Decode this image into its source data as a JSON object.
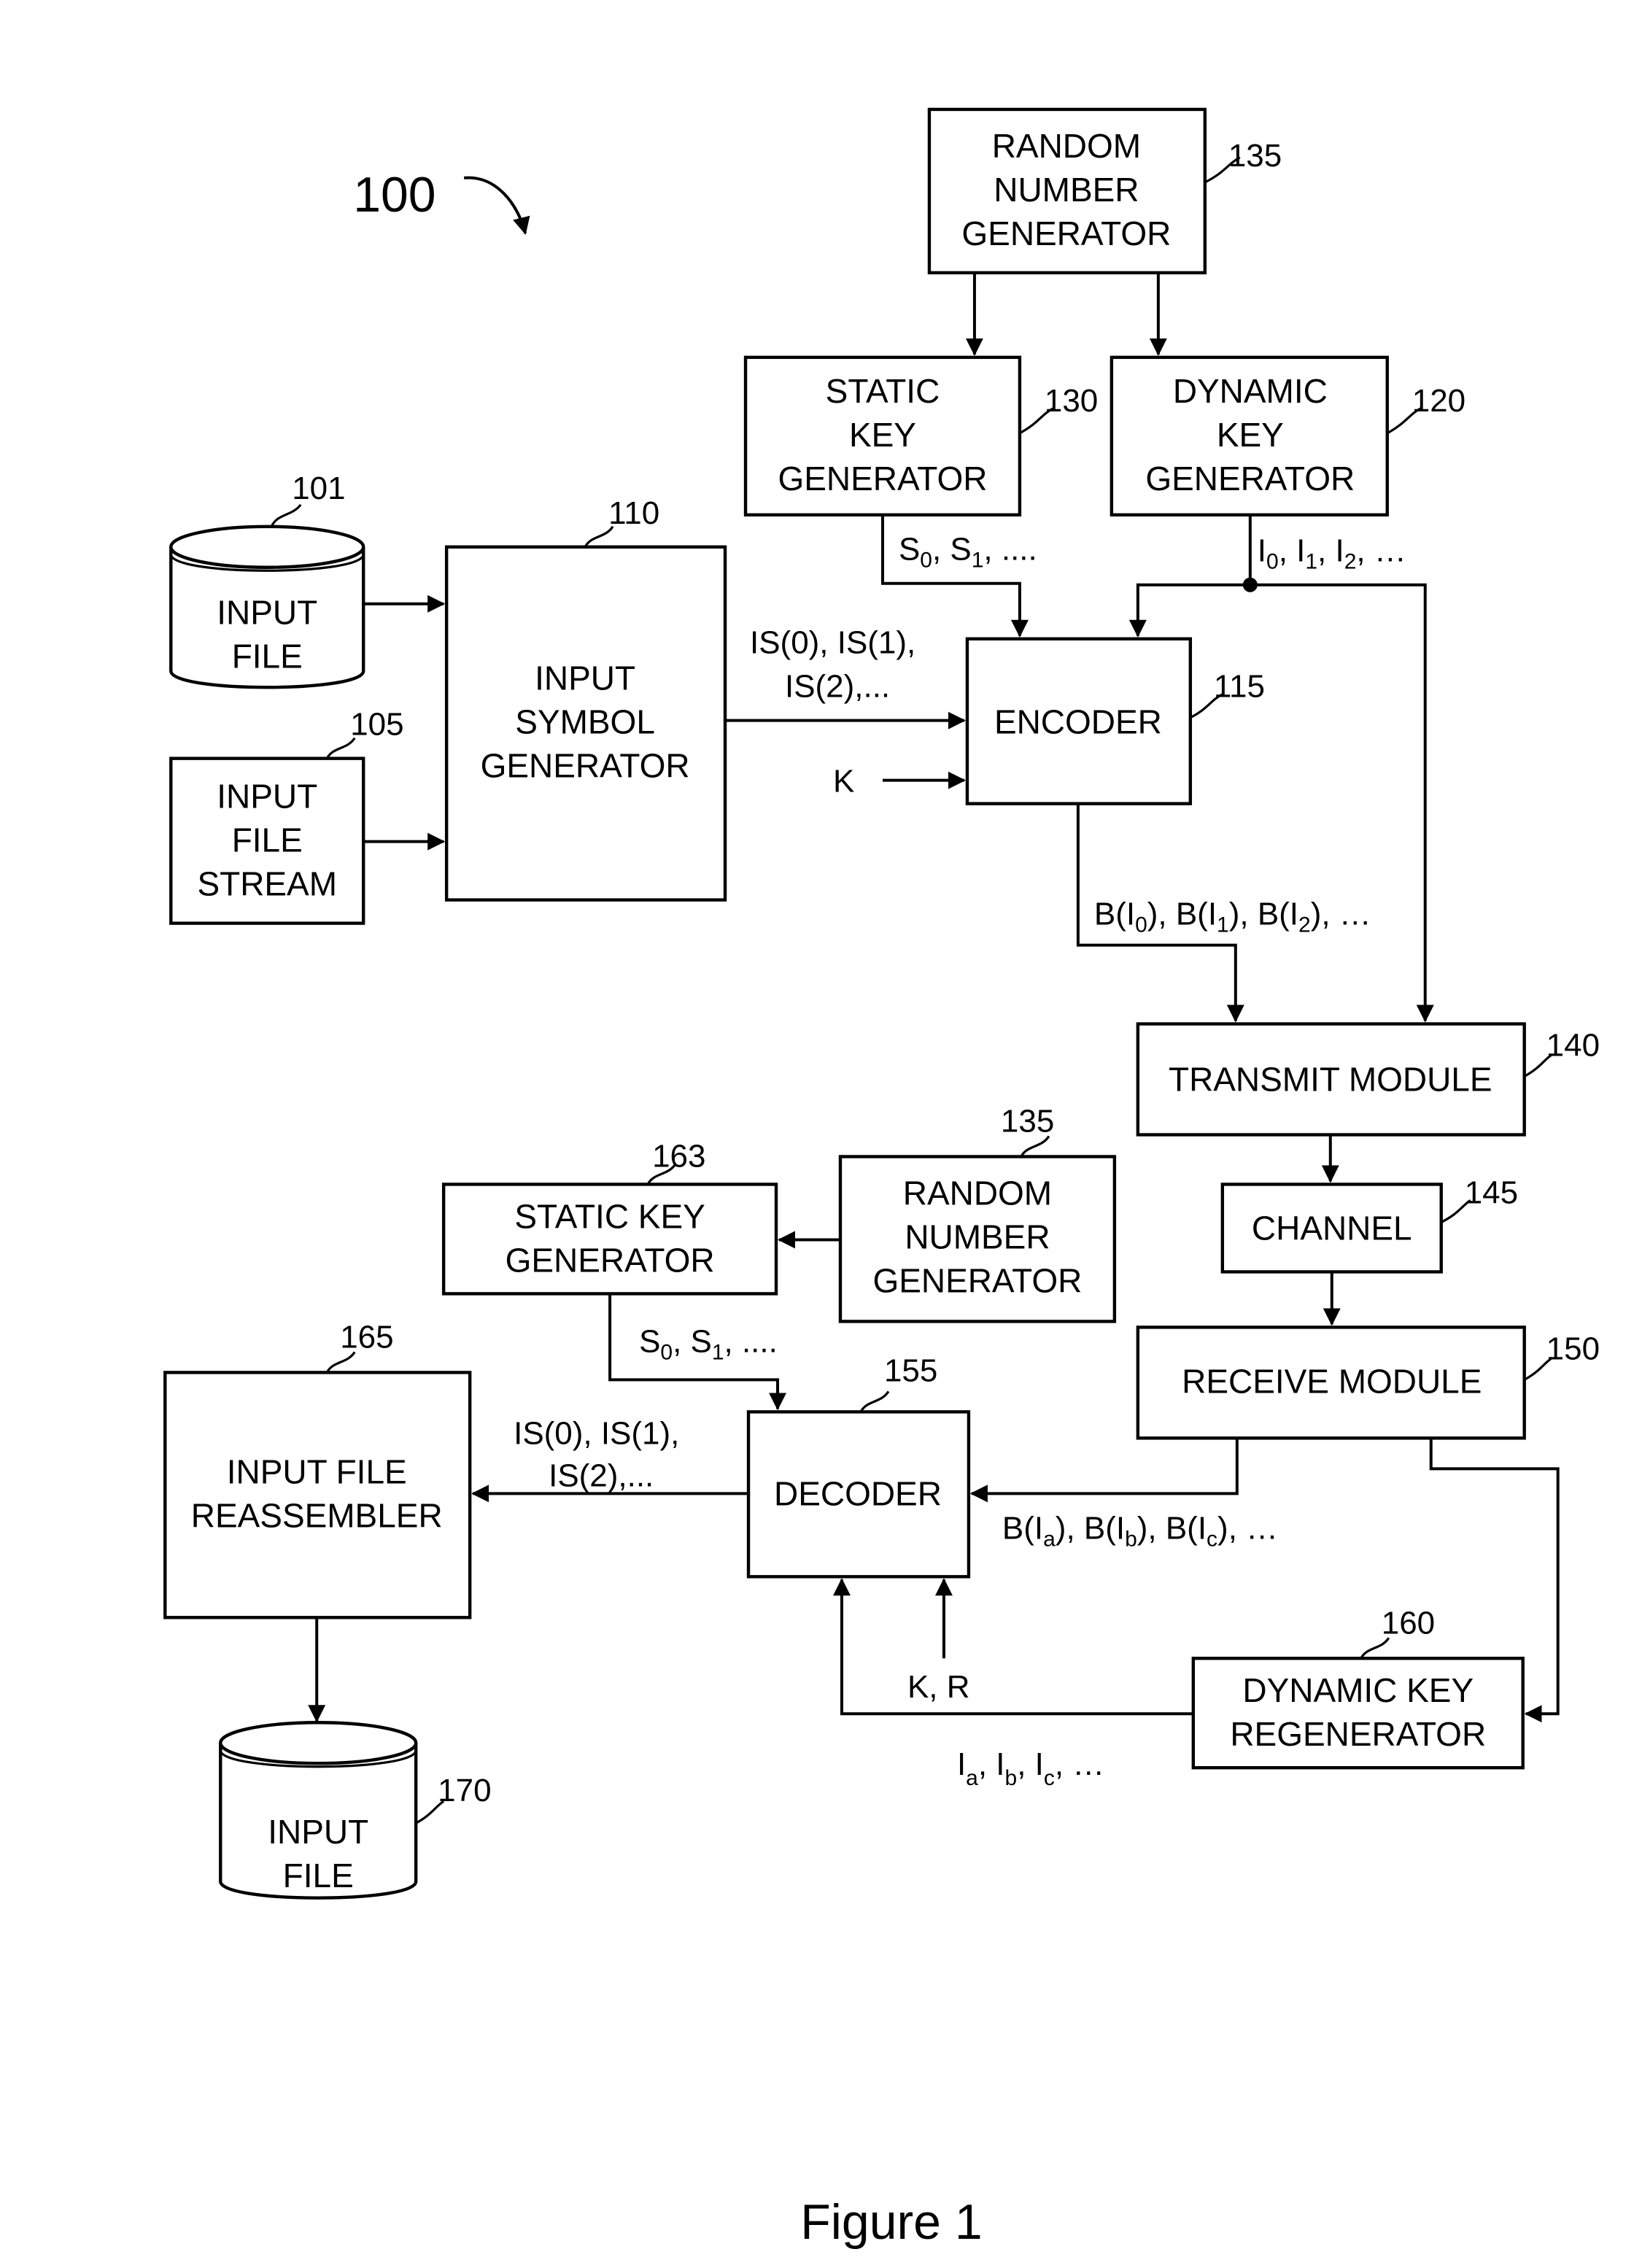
{
  "figure": {
    "reference": "100",
    "caption": "Figure 1"
  },
  "blocks": {
    "rng_top": {
      "lines": [
        "RANDOM",
        "NUMBER",
        "GENERATOR"
      ],
      "ref": "135"
    },
    "static_key_gen": {
      "lines": [
        "STATIC",
        "KEY",
        "GENERATOR"
      ],
      "ref": "130"
    },
    "dynamic_key_gen": {
      "lines": [
        "DYNAMIC",
        "KEY",
        "GENERATOR"
      ],
      "ref": "120"
    },
    "input_file": {
      "lines": [
        "INPUT",
        "FILE"
      ],
      "ref": "101"
    },
    "input_file_stream": {
      "lines": [
        "INPUT",
        "FILE",
        "STREAM"
      ],
      "ref": "105"
    },
    "input_symbol_gen": {
      "lines": [
        "INPUT",
        "SYMBOL",
        "GENERATOR"
      ],
      "ref": "110"
    },
    "encoder": {
      "lines": [
        "ENCODER"
      ],
      "ref": "115"
    },
    "transmit_module": {
      "lines": [
        "TRANSMIT MODULE"
      ],
      "ref": "140"
    },
    "channel": {
      "lines": [
        "CHANNEL"
      ],
      "ref": "145"
    },
    "receive_module": {
      "lines": [
        "RECEIVE MODULE"
      ],
      "ref": "150"
    },
    "rng_bottom": {
      "lines": [
        "RANDOM",
        "NUMBER",
        "GENERATOR"
      ],
      "ref": "135"
    },
    "static_key_gen_rx": {
      "lines": [
        "STATIC KEY",
        "GENERATOR"
      ],
      "ref": "163"
    },
    "decoder": {
      "lines": [
        "DECODER"
      ],
      "ref": "155"
    },
    "dynamic_key_regen": {
      "lines": [
        "DYNAMIC KEY",
        "REGENERATOR"
      ],
      "ref": "160"
    },
    "input_file_reassembler": {
      "lines": [
        "INPUT FILE",
        "REASSEMBLER"
      ],
      "ref": "165"
    },
    "input_file_out": {
      "lines": [
        "INPUT",
        "FILE"
      ],
      "ref": "170"
    }
  },
  "signals": {
    "static_keys_tx": {
      "parts": [
        [
          "S",
          "0"
        ],
        [
          "S",
          "1"
        ]
      ],
      "tail": ", ...."
    },
    "dynamic_keys_tx": {
      "parts": [
        [
          "I",
          "0"
        ],
        [
          "I",
          "1"
        ],
        [
          "I",
          "2"
        ]
      ],
      "tail": ", …"
    },
    "input_symbols_tx_line1": "IS(0), IS(1),",
    "input_symbols_tx_line2": "IS(2),...",
    "k_input": "K",
    "output_symbols_tx": {
      "parts": [
        [
          "B(I",
          "0",
          ")"
        ],
        [
          "B(I",
          "1",
          ")"
        ],
        [
          "B(I",
          "2",
          ")"
        ]
      ],
      "tail": ", …"
    },
    "static_keys_rx": {
      "parts": [
        [
          "S",
          "0"
        ],
        [
          "S",
          "1"
        ]
      ],
      "tail": ", ...."
    },
    "input_symbols_rx_line1": "IS(0), IS(1),",
    "input_symbols_rx_line2": "IS(2),...",
    "output_symbols_rx": {
      "parts": [
        [
          "B(I",
          "a",
          ")"
        ],
        [
          "B(I",
          "b",
          ")"
        ],
        [
          "B(I",
          "c",
          ")"
        ]
      ],
      "tail": ", …"
    },
    "k_r_input": "K, R",
    "dynamic_keys_rx": {
      "parts": [
        [
          "I",
          "a"
        ],
        [
          "I",
          "b"
        ],
        [
          "I",
          "c"
        ]
      ],
      "tail": ", …"
    }
  }
}
